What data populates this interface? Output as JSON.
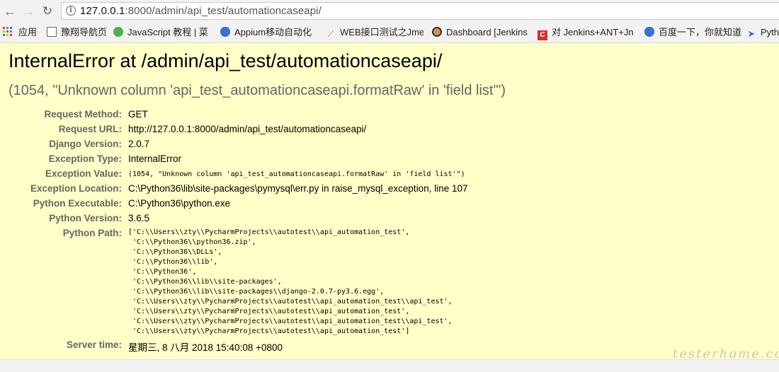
{
  "browser": {
    "url_host": "127.0.0.1",
    "url_rest": ":8000/admin/api_test/automationcaseapi/",
    "bookmarks": [
      {
        "label": "应用",
        "icon": "apps-grid-icon"
      },
      {
        "label": "豫翔导航页",
        "icon": "page-icon"
      },
      {
        "label": "JavaScript 教程 | 菜",
        "icon": "green-circle-icon"
      },
      {
        "label": "Appium移动自动化",
        "icon": "baidu-paw-icon"
      },
      {
        "label": "WEB接口测试之Jme",
        "icon": "slash-icon"
      },
      {
        "label": "Dashboard [Jenkins",
        "icon": "jenkins-face-icon"
      },
      {
        "label": "对 Jenkins+ANT+Jn",
        "icon": "red-c-icon"
      },
      {
        "label": "百度一下，你就知道",
        "icon": "baidu-paw-icon"
      },
      {
        "label": "Pyth",
        "icon": "rocket-icon"
      }
    ]
  },
  "error": {
    "title": "InternalError at /admin/api_test/automationcaseapi/",
    "subtitle": "(1054, \"Unknown column 'api_test_automationcaseapi.formatRaw' in 'field list'\")"
  },
  "meta": [
    {
      "label": "Request Method:",
      "value": "GET",
      "mono": false
    },
    {
      "label": "Request URL:",
      "value": "http://127.0.0.1:8000/admin/api_test/automationcaseapi/",
      "mono": false
    },
    {
      "label": "Django Version:",
      "value": "2.0.7",
      "mono": false
    },
    {
      "label": "Exception Type:",
      "value": "InternalError",
      "mono": false
    },
    {
      "label": "Exception Value:",
      "value": "(1054, \"Unknown column 'api_test_automationcaseapi.formatRaw' in 'field list'\")",
      "mono": true
    },
    {
      "label": "Exception Location:",
      "value": "C:\\Python36\\lib\\site-packages\\pymysql\\err.py in raise_mysql_exception, line 107",
      "mono": false
    },
    {
      "label": "Python Executable:",
      "value": "C:\\Python36\\python.exe",
      "mono": false
    },
    {
      "label": "Python Version:",
      "value": "3.6.5",
      "mono": false
    }
  ],
  "python_path_label": "Python Path:",
  "python_path": [
    "['C:\\\\Users\\\\zty\\\\PycharmProjects\\\\autotest\\\\api_automation_test',",
    " 'C:\\\\Python36\\\\python36.zip',",
    " 'C:\\\\Python36\\\\DLLs',",
    " 'C:\\\\Python36\\\\lib',",
    " 'C:\\\\Python36',",
    " 'C:\\\\Python36\\\\lib\\\\site-packages',",
    " 'C:\\\\Python36\\\\lib\\\\site-packages\\\\django-2.0.7-py3.6.egg',",
    " 'C:\\\\Users\\\\zty\\\\PycharmProjects\\\\autotest\\\\api_automation_test\\\\api_test',",
    " 'C:\\\\Users\\\\zty\\\\PycharmProjects\\\\autotest\\\\api_automation_test',",
    " 'C:\\\\Users\\\\zty\\\\PycharmProjects\\\\autotest\\\\api_automation_test\\\\api_test',",
    " 'C:\\\\Users\\\\zty\\\\PycharmProjects\\\\autotest\\\\api_automation_test']"
  ],
  "server_time_label": "Server time:",
  "server_time": "星期三, 8 八月 2018 15:40:08 +0800",
  "watermark": "testerhome.com"
}
